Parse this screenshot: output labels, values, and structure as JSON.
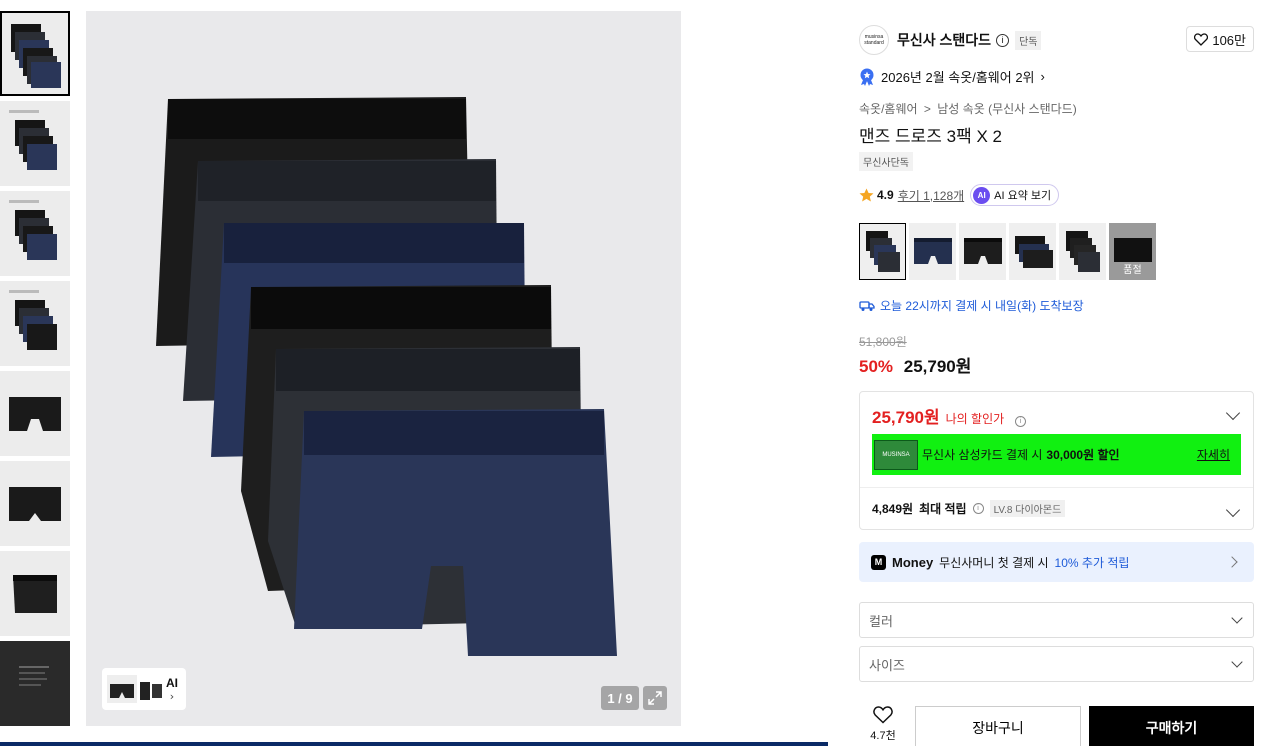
{
  "gallery": {
    "thumbnails": [
      {
        "name": "thumb-1",
        "style": "stack-6"
      },
      {
        "name": "thumb-2",
        "style": "stack-5"
      },
      {
        "name": "thumb-3",
        "style": "stack-5"
      },
      {
        "name": "thumb-4",
        "style": "stack-5"
      },
      {
        "name": "thumb-5",
        "style": "single-black"
      },
      {
        "name": "thumb-6",
        "style": "single-black-back"
      },
      {
        "name": "thumb-7",
        "style": "single-black-side"
      },
      {
        "name": "thumb-8",
        "style": "label-dark"
      }
    ],
    "counter": "1 / 9",
    "ai_label": "AI",
    "colors": {
      "black": "#141414",
      "charcoal": "#2b2e35",
      "navy": "#2a3658",
      "bg": "#e9e9eb"
    }
  },
  "brand": {
    "logo_text": "musinsa standard",
    "name": "무신사 스탠다드",
    "tag": "단독",
    "likes": "106만"
  },
  "ranking": "2026년 2월 속옷/홈웨어 2위",
  "breadcrumb": {
    "cat1": "속옷/홈웨어",
    "sep": ">",
    "cat2": "남성 속옷 (무신사 스탠다드)"
  },
  "product": {
    "title": "맨즈 드로즈 3팩 X 2",
    "exclusive_tag": "무신사단독",
    "rating": "4.9",
    "reviews": "후기 1,128개",
    "ai_summary": "AI 요약 보기",
    "ai_badge": "AI"
  },
  "swatches": [
    {
      "name": "swatch-1",
      "selected": true
    },
    {
      "name": "swatch-2",
      "selected": false
    },
    {
      "name": "swatch-3",
      "selected": false
    },
    {
      "name": "swatch-4",
      "selected": false
    },
    {
      "name": "swatch-5",
      "selected": false
    },
    {
      "name": "swatch-6",
      "soldout_label": "품절"
    }
  ],
  "delivery": "오늘 22시까지 결제 시 내일(화) 도착보장",
  "price": {
    "original": "51,800원",
    "discount_pct": "50%",
    "sale": "25,790원"
  },
  "discount_box": {
    "my_price": "25,790원",
    "my_price_label": "나의 할인가",
    "card_text": "무신사 삼성카드 결제 시",
    "card_amount": "30,000원 할인",
    "card_detail": "자세히",
    "card_img_text": "MUSINSA",
    "points_value": "4,849원",
    "points_label": "최대 적립",
    "level": "LV.8 다이아몬드",
    "banner_color": "#11f011"
  },
  "money": {
    "logo": "M",
    "brand": "Money",
    "text": "무신사머니 첫 결제 시",
    "highlight": "10% 추가 적립"
  },
  "options": {
    "color_placeholder": "컬러",
    "size_placeholder": "사이즈"
  },
  "actions": {
    "wish_count": "4.7천",
    "cart": "장바구니",
    "buy": "구매하기"
  },
  "accent": {
    "red": "#e32020",
    "blue": "#1e5bd8"
  }
}
